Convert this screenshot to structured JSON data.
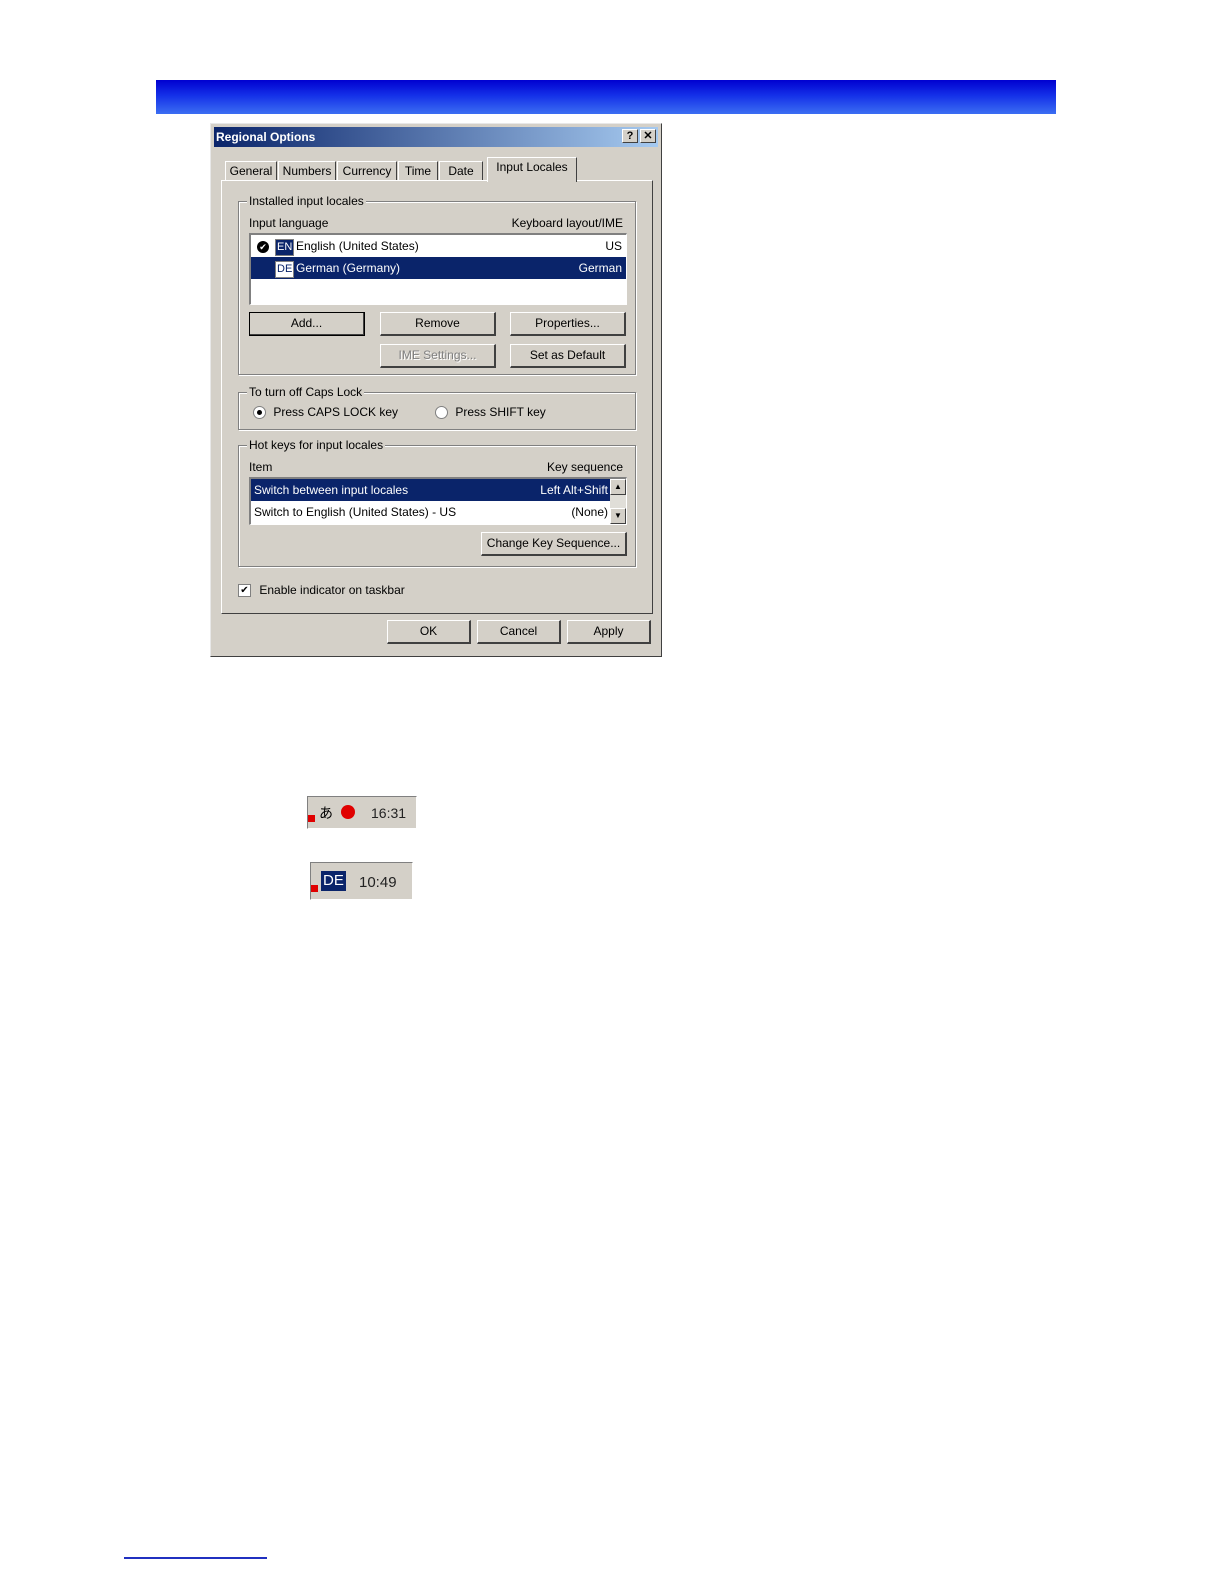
{
  "dialog": {
    "title": "Regional Options",
    "help_label": "?",
    "close_label": "✕",
    "tabs": [
      "General",
      "Numbers",
      "Currency",
      "Time",
      "Date",
      "Input Locales"
    ],
    "installed": {
      "group_label": "Installed input locales",
      "col_language": "Input language",
      "col_layout": "Keyboard layout/IME",
      "rows": [
        {
          "code": "EN",
          "name": "English (United States)",
          "layout": "US"
        },
        {
          "code": "DE",
          "name": "German (Germany)",
          "layout": "German"
        }
      ],
      "add_label": "Add...",
      "remove_label": "Remove",
      "properties_label": "Properties...",
      "ime_label": "IME Settings...",
      "default_label": "Set as Default"
    },
    "caps": {
      "group_label": "To turn off Caps Lock",
      "option1": "Press CAPS LOCK key",
      "option2": "Press SHIFT key"
    },
    "hotkeys": {
      "group_label": "Hot keys for input locales",
      "col_item": "Item",
      "col_seq": "Key sequence",
      "rows": [
        {
          "item": "Switch between input locales",
          "seq": "Left Alt+Shift"
        },
        {
          "item": "Switch to English (United States) - US",
          "seq": "(None)"
        }
      ],
      "change_label": "Change Key Sequence..."
    },
    "enable_indicator": "Enable indicator on taskbar",
    "ok_label": "OK",
    "cancel_label": "Cancel",
    "apply_label": "Apply"
  },
  "tray1": {
    "time": "16:31"
  },
  "tray2": {
    "badge": "DE",
    "time": "10:49"
  },
  "colors": {
    "selection": "#0a246a",
    "banner": "#1430e8",
    "face": "#d4d0c8"
  }
}
